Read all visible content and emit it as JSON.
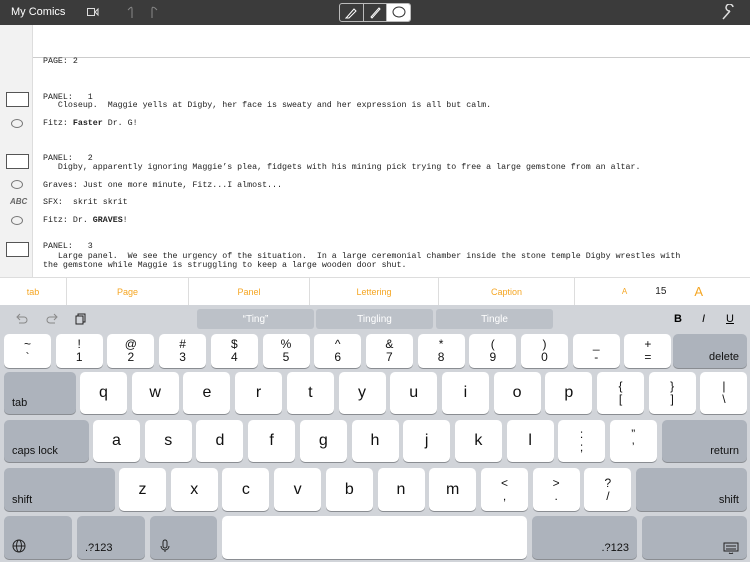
{
  "topbar": {
    "title": "My Comics",
    "icons": [
      "video-icon",
      "undo-icon",
      "redo-icon",
      "pencil-icon",
      "pen-icon",
      "speech-bubble-icon",
      "wrench-icon"
    ]
  },
  "script": [
    {
      "text": "PAGE: 2"
    },
    {
      "text": "PANEL:   1"
    },
    {
      "text": "   Closeup.  Maggie yells at Digby, her face is sweaty and her expression is all but calm."
    },
    {
      "pre": "Fitz: ",
      "bold": "Faster",
      "post": " Dr. G!"
    },
    {
      "text": "PANEL:   2"
    },
    {
      "text": "   Digby, apparently ignoring Maggie’s plea, fidgets with his mining pick trying to free a large gemstone from an altar."
    },
    {
      "text": "Graves: Just one more minute, Fitz...I almost..."
    },
    {
      "text": "SFX:  skrit skrit"
    },
    {
      "pre": "Fitz: Dr. ",
      "bold": "GRAVES",
      "post": "!"
    },
    {
      "text": "PANEL:   3"
    },
    {
      "text": "   Large panel.  We see the urgency of the situation.  In a large ceremonial chamber inside the stone temple Digby wrestles with"
    },
    {
      "text": "the gemstone while Maggie is struggling to keep a large wooden door shut."
    }
  ],
  "format_bar": {
    "items": [
      "tab",
      "Page",
      "Panel",
      "Lettering",
      "Caption"
    ],
    "font_small": "A",
    "font_size": "15",
    "font_large": "A",
    "accent": "#f5a623"
  },
  "suggestions": [
    "“Ting”",
    "Tingling",
    "Tingle"
  ],
  "style_buttons": [
    "B",
    "I",
    "U"
  ],
  "keyboard": {
    "row1": [
      [
        "~",
        "`"
      ],
      [
        "!",
        "1"
      ],
      [
        "@",
        "2"
      ],
      [
        "#",
        "3"
      ],
      [
        "$",
        "4"
      ],
      [
        "%",
        "5"
      ],
      [
        "^",
        "6"
      ],
      [
        "&",
        "7"
      ],
      [
        "*",
        "8"
      ],
      [
        "(",
        "9"
      ],
      [
        ")",
        "0"
      ],
      [
        "_",
        "-"
      ],
      [
        "+",
        "="
      ]
    ],
    "delete": "delete",
    "tab": "tab",
    "row2": [
      "q",
      "w",
      "e",
      "r",
      "t",
      "y",
      "u",
      "i",
      "o",
      "p"
    ],
    "row2b": [
      [
        "{",
        "["
      ],
      [
        "}",
        "]"
      ],
      [
        "|",
        "\\"
      ]
    ],
    "caps": "caps lock",
    "row3": [
      "a",
      "s",
      "d",
      "f",
      "g",
      "h",
      "j",
      "k",
      "l"
    ],
    "row3b": [
      [
        ":",
        ";"
      ],
      [
        "”",
        "’"
      ]
    ],
    "return": "return",
    "shift": "shift",
    "row4": [
      "z",
      "x",
      "c",
      "v",
      "b",
      "n",
      "m"
    ],
    "row4b": [
      [
        "<",
        ","
      ],
      [
        ">",
        "."
      ],
      [
        "?",
        "/"
      ]
    ],
    "num": ".?123"
  }
}
